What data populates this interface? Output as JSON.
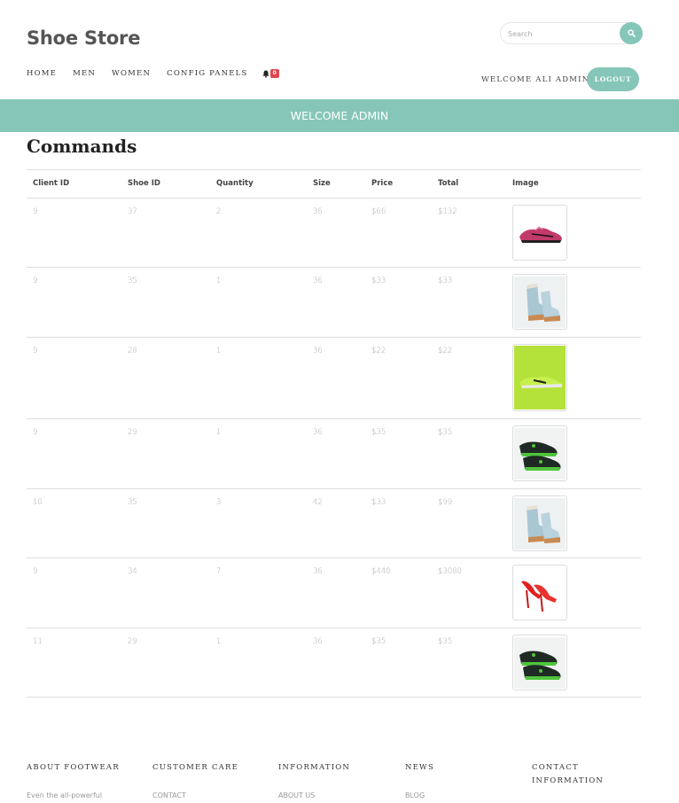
{
  "header": {
    "brand": "Shoe Store",
    "search_placeholder": "Search",
    "nav": [
      "HOME",
      "MEN",
      "WOMEN",
      "CONFIG PANELS"
    ],
    "notification_count": "0",
    "welcome_user": "WELCOME ALI ADMIN",
    "logout_label": "LOGOUT"
  },
  "banner": {
    "text": "WELCOME ADMIN"
  },
  "page": {
    "title": "Commands"
  },
  "table": {
    "headers": [
      "Client ID",
      "Shoe ID",
      "Quantity",
      "Size",
      "Price",
      "Total",
      "Image"
    ],
    "rows": [
      {
        "client_id": "9",
        "shoe_id": "37",
        "quantity": "2",
        "size": "36",
        "price": "$66",
        "total": "$132",
        "image": "pink-sneaker"
      },
      {
        "client_id": "9",
        "shoe_id": "35",
        "quantity": "1",
        "size": "36",
        "price": "$33",
        "total": "$33",
        "image": "blue-boots"
      },
      {
        "client_id": "9",
        "shoe_id": "28",
        "quantity": "1",
        "size": "36",
        "price": "$22",
        "total": "$22",
        "image": "green-sneaker"
      },
      {
        "client_id": "9",
        "shoe_id": "29",
        "quantity": "1",
        "size": "36",
        "price": "$35",
        "total": "$35",
        "image": "black-green-sneakers"
      },
      {
        "client_id": "10",
        "shoe_id": "35",
        "quantity": "3",
        "size": "42",
        "price": "$33",
        "total": "$99",
        "image": "blue-boots"
      },
      {
        "client_id": "9",
        "shoe_id": "34",
        "quantity": "7",
        "size": "36",
        "price": "$440",
        "total": "$3080",
        "image": "red-heels"
      },
      {
        "client_id": "11",
        "shoe_id": "29",
        "quantity": "1",
        "size": "36",
        "price": "$35",
        "total": "$35",
        "image": "black-green-sneakers"
      }
    ]
  },
  "footer": {
    "columns": [
      {
        "title": "ABOUT FOOTWEAR",
        "first_item": "Even the all-powerful"
      },
      {
        "title": "CUSTOMER CARE",
        "first_item": "CONTACT"
      },
      {
        "title": "INFORMATION",
        "first_item": "ABOUT US"
      },
      {
        "title": "NEWS",
        "first_item": "BLOG"
      },
      {
        "title": "CONTACT INFORMATION",
        "first_item": ""
      }
    ]
  },
  "colors": {
    "accent": "#86c6b8",
    "badge": "#e0474c"
  }
}
